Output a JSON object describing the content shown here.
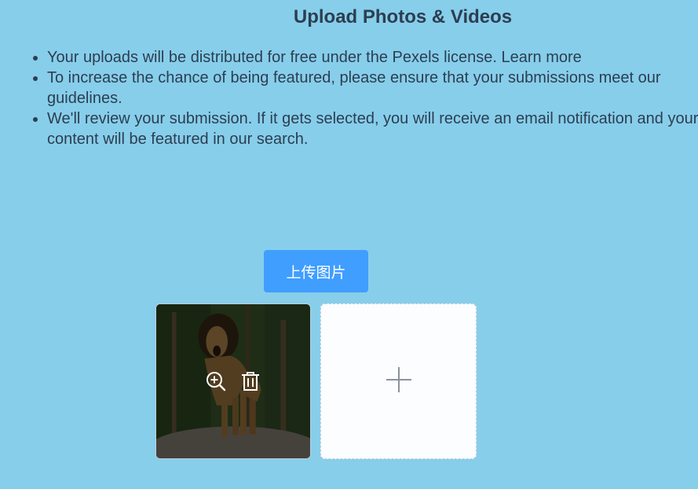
{
  "title": "Upload Photos & Videos",
  "guidelines": [
    "Your uploads will be distributed for free under the Pexels license. Learn more",
    "To increase the chance of being featured, please ensure that your submissions meet our guidelines.",
    "We'll review your submission. If it gets selected, you will receive an email notification and your content will be featured in our search."
  ],
  "upload_button": {
    "label": "上传图片"
  },
  "uploaded_files": [
    {
      "subject": "lion",
      "actions": [
        "zoom-in-icon",
        "delete-icon"
      ]
    }
  ],
  "add_tile": {
    "icon": "plus-icon"
  },
  "colors": {
    "background": "#87ceeb",
    "primary_button": "#409eff",
    "text": "#2c3e50",
    "add_tile_bg": "#fbfdff",
    "plus_icon": "#8c939d"
  }
}
